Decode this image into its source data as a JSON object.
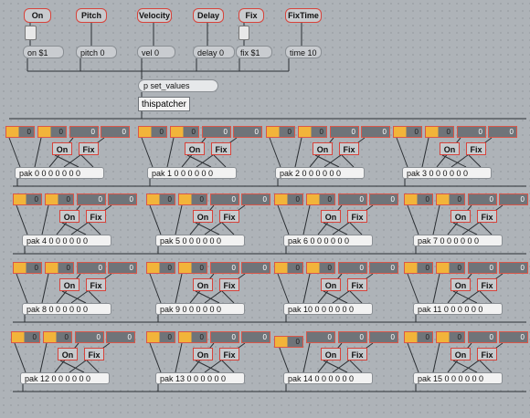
{
  "top_buttons": [
    "On",
    "Pitch",
    "Velocity",
    "Delay",
    "Fix",
    "FixTime"
  ],
  "top_messages": [
    "on $1",
    "pitch 0",
    "vel 0",
    "delay 0",
    "fix $1",
    "time 10"
  ],
  "set_values_object": "p set_values",
  "thispatcher_object": "thispatcher",
  "number_value": "0",
  "channel_buttons": [
    "On",
    "Fix"
  ],
  "pak_messages": [
    "pak 0 0 0 0 0 0 0",
    "pak 1 0 0 0 0 0 0",
    "pak 2 0 0 0 0 0 0",
    "pak 3 0 0 0 0 0 0",
    "pak 4 0 0 0 0 0 0",
    "pak 5 0 0 0 0 0 0",
    "pak 6 0 0 0 0 0 0",
    "pak 7 0 0 0 0 0 0",
    "pak 8 0 0 0 0 0 0",
    "pak 9 0 0 0 0 0 0",
    "pak 10 0 0 0 0 0 0",
    "pak 11 0 0 0 0 0 0",
    "pak 12 0 0 0 0 0 0",
    "pak 13 0 0 0 0 0 0",
    "pak 14 0 0 0 0 0 0",
    "pak 15 0 0 0 0 0 0"
  ],
  "colors": {
    "background": "#aeb3b8",
    "accent_border": "#d7433b",
    "active_number": "#f2b43a",
    "wire": "#2b2f33"
  }
}
